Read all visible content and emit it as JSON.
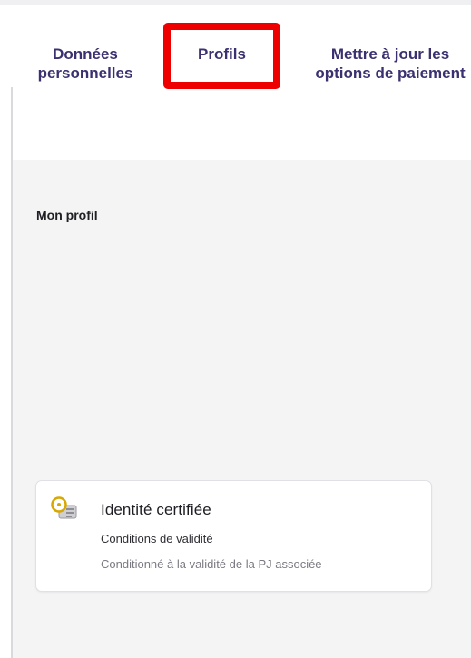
{
  "tabs": {
    "personal_line1": "Données",
    "personal_line2": "personnelles",
    "profiles": "Profils",
    "update_line1": "Mettre à jour les",
    "update_line2": "options de paiement"
  },
  "section": {
    "title": "Mon profil"
  },
  "card": {
    "icon": "certified-id-icon",
    "title": "Identité certifiée",
    "subtitle": "Conditions de validité",
    "description": "Conditionné à la validité de la PJ associée"
  },
  "colors": {
    "tab_text": "#3b3170",
    "highlight": "#ee0000",
    "icon_accent": "#d9a800"
  }
}
